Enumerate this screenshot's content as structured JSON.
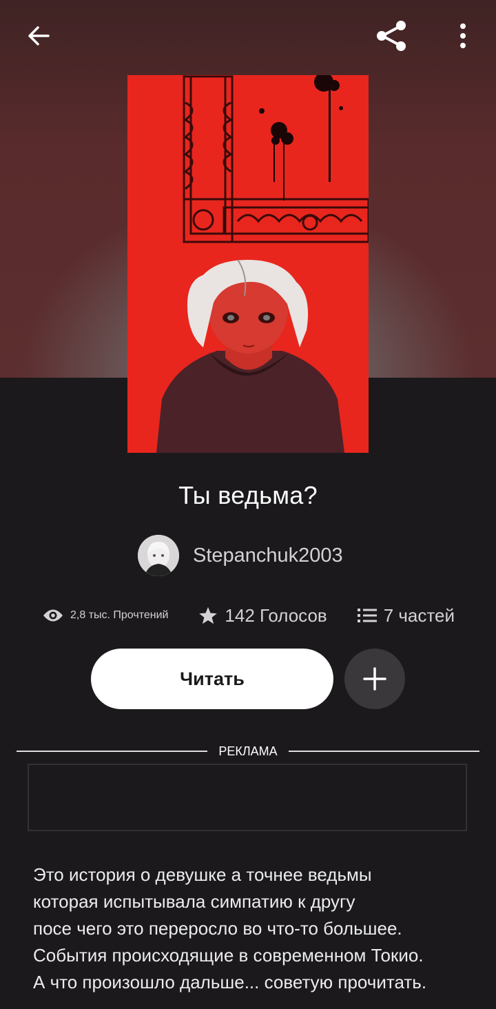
{
  "header": {
    "back_icon": "arrow-left-icon",
    "share_icon": "share-icon",
    "menu_icon": "more-vertical-icon"
  },
  "story": {
    "title": "Ты ведьма?",
    "author": "Stepanchuk2003"
  },
  "stats": {
    "reads": "2,8 тыс. Прочтений",
    "votes": "142 Голосов",
    "parts": "7 частей"
  },
  "actions": {
    "read_label": "Читать"
  },
  "ad": {
    "label": "РЕКЛАМА"
  },
  "description": {
    "lines": [
      "Это история о девушке а точнее ведьмы",
      "которая испытывала симпатию к другу",
      "посе чего это переросло во что-то большее.",
      "События происходящие в современном Токио.",
      "А что произошло дальше... советую прочитать."
    ]
  },
  "colors": {
    "background": "#1b191c",
    "cover_red": "#e8261e",
    "button_white": "#ffffff",
    "add_button": "#3a383b"
  }
}
